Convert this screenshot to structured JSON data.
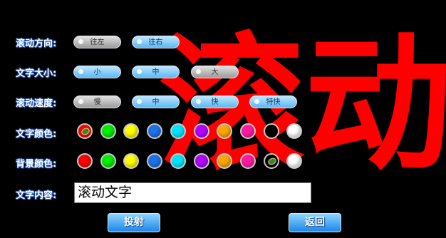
{
  "preview_text": "滚动",
  "rows": {
    "direction": {
      "label": "滚动方向:",
      "options": [
        "往左",
        "往右"
      ],
      "selected": 1
    },
    "size": {
      "label": "文字大小:",
      "options": [
        "小",
        "中",
        "大"
      ],
      "selected": 1
    },
    "speed": {
      "label": "滚动速度:",
      "options": [
        "慢",
        "中",
        "快",
        "特快"
      ],
      "selected": 2
    },
    "text_color": {
      "label": "文字颜色:",
      "selected_index": 0
    },
    "bg_color": {
      "label": "背景颜色:",
      "selected_index": 8
    },
    "content": {
      "label": "文字内容:",
      "value": "滚动文字"
    }
  },
  "palette": [
    "#ff0000",
    "#00ee00",
    "#ffff00",
    "#1e72e8",
    "#00e5ff",
    "#b300ff",
    "#ffa500",
    "#ff1aa3",
    "#000000",
    "#ffffff"
  ],
  "buttons": {
    "project": "投射",
    "back": "返回"
  }
}
